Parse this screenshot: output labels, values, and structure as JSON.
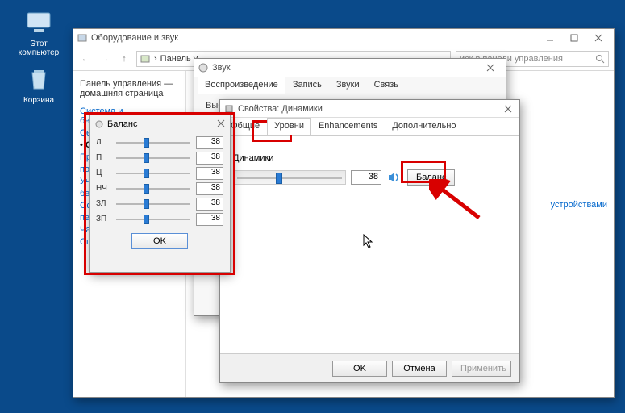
{
  "desktop": {
    "pc_label": "Этот компьютер",
    "bin_label": "Корзина"
  },
  "main_window": {
    "title": "Оборудование и звук",
    "breadcrumb": "Панель у",
    "search_placeholder": "иск в панели управления",
    "sidebar": {
      "home": "Панель управления — домашняя страница",
      "items": [
        "Система и безопасность",
        "Се",
        "Об",
        "Пр",
        "по",
        "Уче",
        "бе",
        "Оф",
        "пе",
        "Ча",
        "Сп"
      ]
    },
    "links": [
      "устройствами"
    ]
  },
  "sound_window": {
    "title": "Звук",
    "tabs": [
      "Воспроизведение",
      "Запись",
      "Звуки",
      "Связь"
    ],
    "instruction": "Выберите устройство воспроизведения, параметры которого нужно из"
  },
  "props_window": {
    "title": "Свойства: Динамики",
    "tabs": [
      "Общие",
      "Уровни",
      "Enhancements",
      "Дополнительно"
    ],
    "active_tab": 1,
    "group_label": "Динамики",
    "level_value": "38",
    "balance_btn": "Баланс",
    "footer": {
      "ok": "OK",
      "cancel": "Отмена",
      "apply": "Применить"
    }
  },
  "balance_window": {
    "title": "Баланс",
    "channels": [
      {
        "label": "Л",
        "value": "38"
      },
      {
        "label": "П",
        "value": "38"
      },
      {
        "label": "Ц",
        "value": "38"
      },
      {
        "label": "НЧ",
        "value": "38"
      },
      {
        "label": "ЗЛ",
        "value": "38"
      },
      {
        "label": "ЗП",
        "value": "38"
      }
    ],
    "ok": "OK"
  },
  "colors": {
    "highlight": "#d80000"
  }
}
